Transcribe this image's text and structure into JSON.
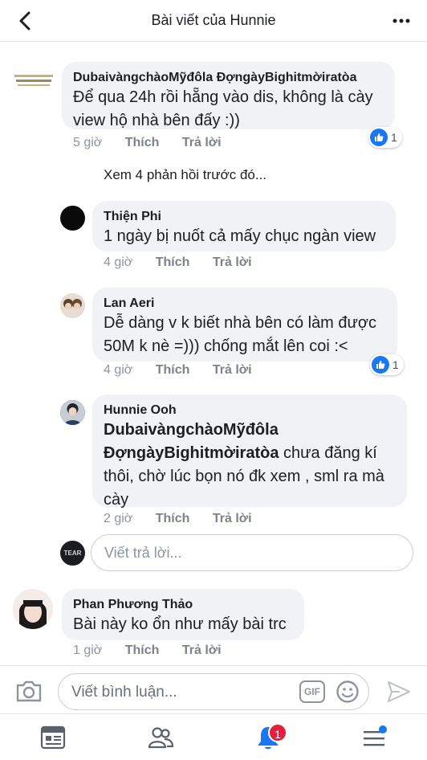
{
  "header": {
    "title": "Bài viết của Hunnie"
  },
  "comments": [
    {
      "name": "DubaivàngchàoMỹđôla ĐợngàyBighitmờiratòa",
      "text": "Để qua 24h rồi hẵng vào dis, không là cày view hộ nhà bên đấy :))",
      "time": "5 giờ",
      "like": "Thích",
      "reply": "Trả lời",
      "reactions": "1"
    }
  ],
  "prev_replies": "Xem 4 phản hồi trước đó...",
  "replies": [
    {
      "name": "Thiện Phi",
      "text": "1 ngày bị nuốt cả mấy chục ngàn view",
      "time": "4 giờ",
      "like": "Thích",
      "reply": "Trả lời"
    },
    {
      "name": "Lan Aeri",
      "text": "Dễ dàng v k biết nhà bên có làm được 50M k nè =))) chống mắt lên coi :<",
      "time": "4 giờ",
      "like": "Thích",
      "reply": "Trả lời",
      "reactions": "1"
    },
    {
      "name": "Hunnie Ooh",
      "mention_1": "DubaivàngchàoMỹđôla",
      "mention_2": "ĐợngàyBighitmờiratòa",
      "text": "chưa đăng kí thôi, chờ lúc bọn nó đk xem , sml ra mà cày",
      "time": "2 giờ",
      "like": "Thích",
      "reply": "Trả lời"
    }
  ],
  "reply_input": {
    "placeholder": "Viết trả lời...",
    "avatar_text": "TEAR"
  },
  "last_comment": {
    "name": "Phan Phương Thảo",
    "text": "Bài này ko ổn như mấy bài trc",
    "time": "1 giờ",
    "like": "Thích",
    "reply": "Trả lời"
  },
  "composer": {
    "placeholder": "Viết bình luận...",
    "gif_label": "GIF"
  },
  "tabbar": {
    "notification_count": "1"
  },
  "colors": {
    "accent": "#1877f2",
    "badge": "#e41e3f",
    "bubble": "#f0f2f5"
  }
}
